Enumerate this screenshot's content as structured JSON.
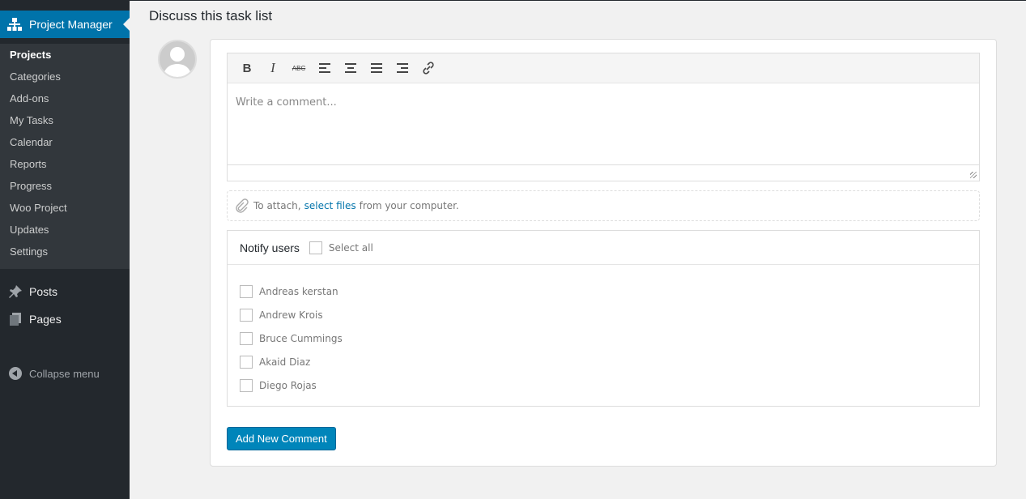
{
  "sidebar": {
    "header": "Project Manager",
    "submenu": [
      "Projects",
      "Categories",
      "Add-ons",
      "My Tasks",
      "Calendar",
      "Reports",
      "Progress",
      "Woo Project",
      "Updates",
      "Settings"
    ],
    "posts": "Posts",
    "pages": "Pages",
    "collapse": "Collapse menu"
  },
  "main": {
    "title": "Discuss this task list",
    "editor": {
      "placeholder": "Write a comment...",
      "tools": [
        "bold-icon",
        "italic-icon",
        "strikethrough-icon",
        "align-left-icon",
        "align-center-icon",
        "align-justify-icon",
        "align-right-icon",
        "link-icon"
      ]
    },
    "attach": {
      "prefix": "To attach,",
      "link": "select files",
      "suffix": "from your computer."
    },
    "notify": {
      "title": "Notify users",
      "select_all": "Select all",
      "users": [
        "Andreas kerstan",
        "Andrew Krois",
        "Bruce Cummings",
        "Akaid Diaz",
        "Diego Rojas"
      ]
    },
    "submit": "Add New Comment"
  }
}
